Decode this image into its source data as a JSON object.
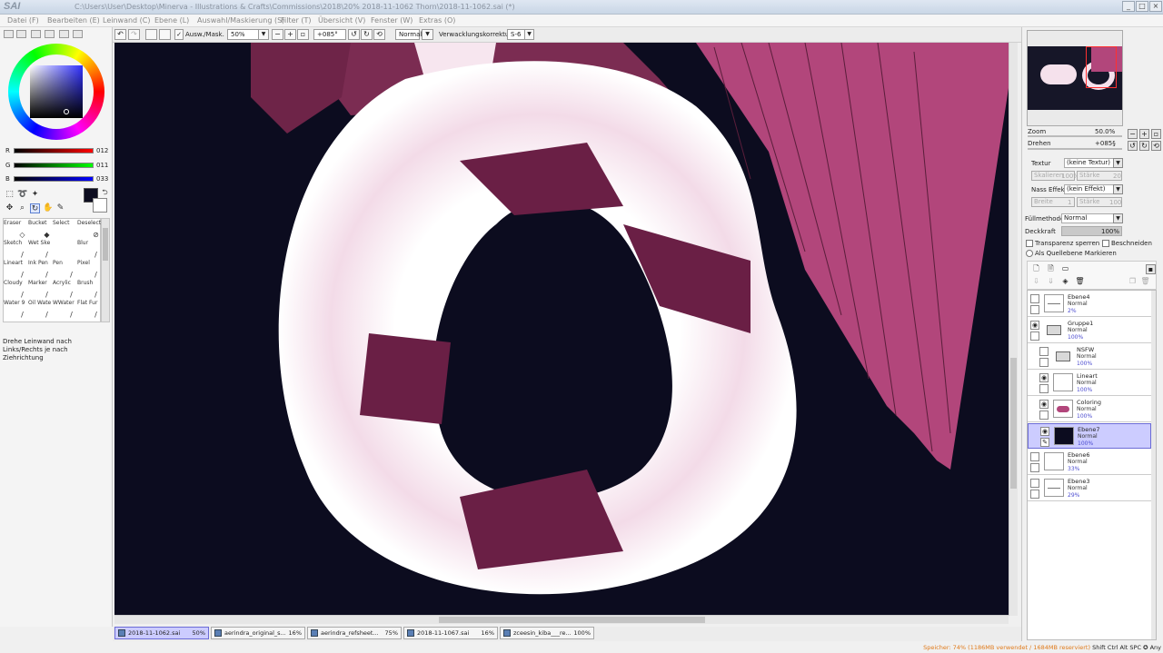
{
  "app": {
    "logo": "SAI",
    "title": "C:\\Users\\User\\Desktop\\Minerva - Illustrations & Crafts\\Commissions\\2018\\20% 2018-11-1062 Thorn\\2018-11-1062.sai (*)"
  },
  "menu": [
    "Datei (F)",
    "Bearbeiten (E)",
    "Leinwand (C)",
    "Ebene (L)",
    "Auswahl/Maskierung (S)",
    "Filter (T)",
    "Übersicht (V)",
    "Fenster (W)",
    "Extras (O)"
  ],
  "color": {
    "fg": "#0c0c1f",
    "r_label": "R",
    "g_label": "G",
    "b_label": "B",
    "r": "012",
    "g": "011",
    "b": "033"
  },
  "brushes": [
    {
      "name": "Eraser",
      "icon": "eraser-icon",
      "glyph": "◇"
    },
    {
      "name": "Bucket",
      "icon": "bucket-icon",
      "glyph": "◆"
    },
    {
      "name": "Select",
      "icon": "select-icon",
      "glyph": ""
    },
    {
      "name": "Deselect",
      "icon": "deselect-icon",
      "glyph": "⊘"
    },
    {
      "name": "Sketch",
      "icon": "pencil-icon",
      "glyph": "/"
    },
    {
      "name": "Wet Ske",
      "icon": "pencil-icon",
      "glyph": "/"
    },
    {
      "name": "",
      "icon": "empty-slot-icon",
      "glyph": ""
    },
    {
      "name": "Blur",
      "icon": "blur-icon",
      "glyph": "/"
    },
    {
      "name": "Lineart",
      "icon": "pen-icon",
      "glyph": "/"
    },
    {
      "name": "Ink Pen",
      "icon": "pen-icon",
      "glyph": "/"
    },
    {
      "name": "Pen",
      "icon": "pen-icon",
      "glyph": "/"
    },
    {
      "name": "Pixel",
      "icon": "pixel-icon",
      "glyph": "/"
    },
    {
      "name": "Cloudy",
      "icon": "brush-icon",
      "glyph": "/"
    },
    {
      "name": "Marker",
      "icon": "marker-icon",
      "glyph": "/"
    },
    {
      "name": "Acrylic",
      "icon": "brush-icon",
      "glyph": "/"
    },
    {
      "name": "Brush",
      "icon": "brush-icon",
      "glyph": "/"
    },
    {
      "name": "Water 9",
      "icon": "water-icon",
      "glyph": "/"
    },
    {
      "name": "Oil Wate",
      "icon": "brush-icon",
      "glyph": "/"
    },
    {
      "name": "WWater",
      "icon": "brush-icon",
      "glyph": "/"
    },
    {
      "name": "Flat Fur",
      "icon": "brush-icon",
      "glyph": "/"
    }
  ],
  "hint": "Drehe Leinwand nach Links/Rechts je nach Ziehrichtung",
  "toolbar": {
    "mask_label": "Ausw./Mask.",
    "zoom": "50%",
    "rotation": "+085°",
    "blend": "Normal",
    "stab_label": "Verwacklungskorrektur",
    "stab": "S-6"
  },
  "navigator": {
    "zoom_label": "Zoom",
    "zoom": "50.0%",
    "rotate_label": "Drehen",
    "rotate": "+085§"
  },
  "props": {
    "texture_label": "Textur",
    "texture": "(keine Textur)",
    "scale_label": "Skalieren",
    "scale": "100%",
    "strength_label": "Stärke",
    "strength": "20",
    "effect_label": "Nass Effekt",
    "effect": "(kein Effekt)",
    "width_label": "Breite",
    "width": "1",
    "strength2": "100",
    "fill_label": "Füllmethode",
    "fill": "Normal",
    "opacity_label": "Deckkraft",
    "opacity": "100%",
    "lock_label": "Transparenz sperren",
    "clip_label": "Beschneiden",
    "source_label": "Als Quellebene Markieren"
  },
  "layers": [
    {
      "name": "Ebene4",
      "mode": "Normal",
      "opacity": "2%",
      "visible": false,
      "indent": 0,
      "kind": "sketch",
      "selected": false
    },
    {
      "name": "Gruppe1",
      "mode": "Normal",
      "opacity": "100%",
      "visible": true,
      "indent": 0,
      "kind": "folder",
      "selected": false
    },
    {
      "name": "NSFW",
      "mode": "Normal",
      "opacity": "100%",
      "visible": false,
      "indent": 1,
      "kind": "folder",
      "selected": false
    },
    {
      "name": "Lineart",
      "mode": "Normal",
      "opacity": "100%",
      "visible": true,
      "indent": 1,
      "kind": "blank",
      "selected": false
    },
    {
      "name": "Coloring",
      "mode": "Normal",
      "opacity": "100%",
      "visible": true,
      "indent": 1,
      "kind": "color",
      "selected": false
    },
    {
      "name": "Ebene7",
      "mode": "Normal",
      "opacity": "100%",
      "visible": true,
      "indent": 1,
      "kind": "dark",
      "selected": true
    },
    {
      "name": "Ebene6",
      "mode": "Normal",
      "opacity": "33%",
      "visible": false,
      "indent": 0,
      "kind": "blank",
      "selected": false
    },
    {
      "name": "Ebene3",
      "mode": "Normal",
      "opacity": "29%",
      "visible": false,
      "indent": 0,
      "kind": "sketch",
      "selected": false
    }
  ],
  "filetabs": [
    {
      "name": "2018-11-1062.sai",
      "pct": "50%",
      "active": true
    },
    {
      "name": "aerindra_original_s...",
      "pct": "16%",
      "active": false
    },
    {
      "name": "aerindra_refsheet...",
      "pct": "75%",
      "active": false
    },
    {
      "name": "2018-11-1067.sai",
      "pct": "16%",
      "active": false
    },
    {
      "name": "zceesin_kiba___re...",
      "pct": "100%",
      "active": false
    }
  ],
  "status": {
    "memory": "Speicher: 74% (1186MB verwendet / 1684MB reserviert)",
    "keys": "Shift Ctrl Alt SPC ✪ Any"
  }
}
